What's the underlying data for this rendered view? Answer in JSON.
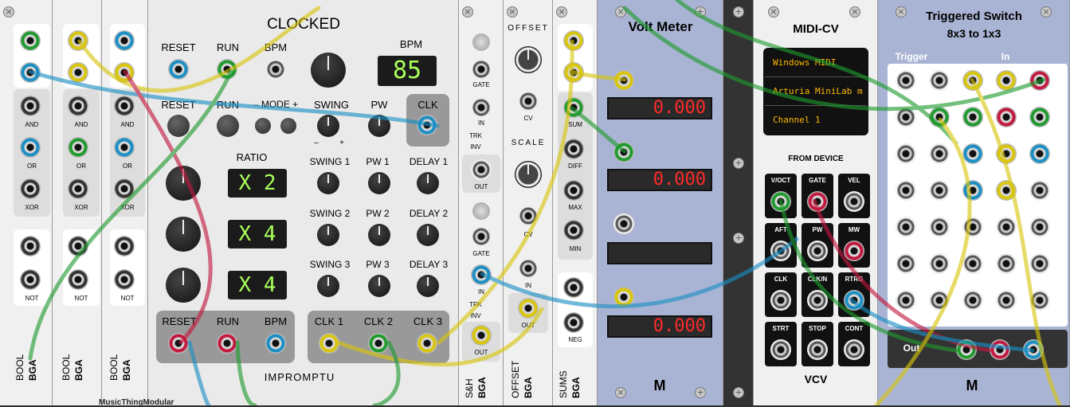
{
  "bool_modules": [
    {
      "title": "BOOL",
      "brand": "BGA",
      "labels": [
        "AND",
        "OR",
        "XOR",
        "NOT"
      ]
    },
    {
      "title": "BOOL",
      "brand": "BGA",
      "labels": [
        "AND",
        "OR",
        "XOR",
        "NOT"
      ]
    },
    {
      "title": "BOOL",
      "brand": "BGA",
      "labels": [
        "AND",
        "OR",
        "XOR",
        "NOT"
      ]
    }
  ],
  "clocked": {
    "title": "CLOCKED",
    "brand": "IMPROMPTU",
    "reset": "RESET",
    "run": "RUN",
    "bpm": "BPM",
    "bpm_display_label": "BPM",
    "bpm_value": "85",
    "mode": "– MODE +",
    "swing": "SWING",
    "pw": "PW",
    "clk": "CLK",
    "swing_minus": "–",
    "swing_plus": "+",
    "ratio": "RATIO",
    "ratios": [
      {
        "value": "X 2",
        "swing": "SWING 1",
        "pw": "PW 1",
        "delay": "DELAY 1"
      },
      {
        "value": "X 4",
        "swing": "SWING 2",
        "pw": "PW 2",
        "delay": "DELAY 2"
      },
      {
        "value": "X 4",
        "swing": "SWING 3",
        "pw": "PW 3",
        "delay": "DELAY 3"
      }
    ],
    "out_reset": "RESET",
    "out_run": "RUN",
    "out_bpm": "BPM",
    "clk1": "CLK 1",
    "clk2": "CLK 2",
    "clk3": "CLK 3"
  },
  "sh": {
    "title": "S&H",
    "brand": "BGA",
    "gate": "GATE",
    "in": "IN",
    "trk": "TRK",
    "inv": "INV",
    "out": "OUT"
  },
  "offset": {
    "title": "OFFSET",
    "brand": "BGA",
    "offset": "OFFSET",
    "scale": "SCALE",
    "cv": "CV",
    "in": "IN",
    "out": "OUT"
  },
  "sums": {
    "title": "SUMS",
    "brand": "BGA",
    "sum": "SUM",
    "diff": "DIFF",
    "max": "MAX",
    "min": "MIN",
    "neg": "NEG"
  },
  "voltmeter": {
    "title": "Volt Meter",
    "readings": [
      "0.000",
      "0.000",
      "",
      "0.000"
    ],
    "brand": "M"
  },
  "midicv": {
    "title": "MIDI-CV",
    "driver": "Windows MIDI",
    "device": "Arturia MiniLab m",
    "channel": "Channel 1",
    "from": "FROM DEVICE",
    "brand": "VCV",
    "jacks": [
      "V/OCT",
      "GATE",
      "VEL",
      "AFT",
      "PW",
      "MW",
      "CLK",
      "CLK/N",
      "RTRG",
      "STRT",
      "STOP",
      "CONT"
    ]
  },
  "tswitch": {
    "title": "Triggered Switch",
    "subtitle": "8x3 to 1x3",
    "trigger": "Trigger",
    "in": "In",
    "out": "Out",
    "brand": "M"
  },
  "bottom": {
    "label": "MusicThingModular"
  }
}
